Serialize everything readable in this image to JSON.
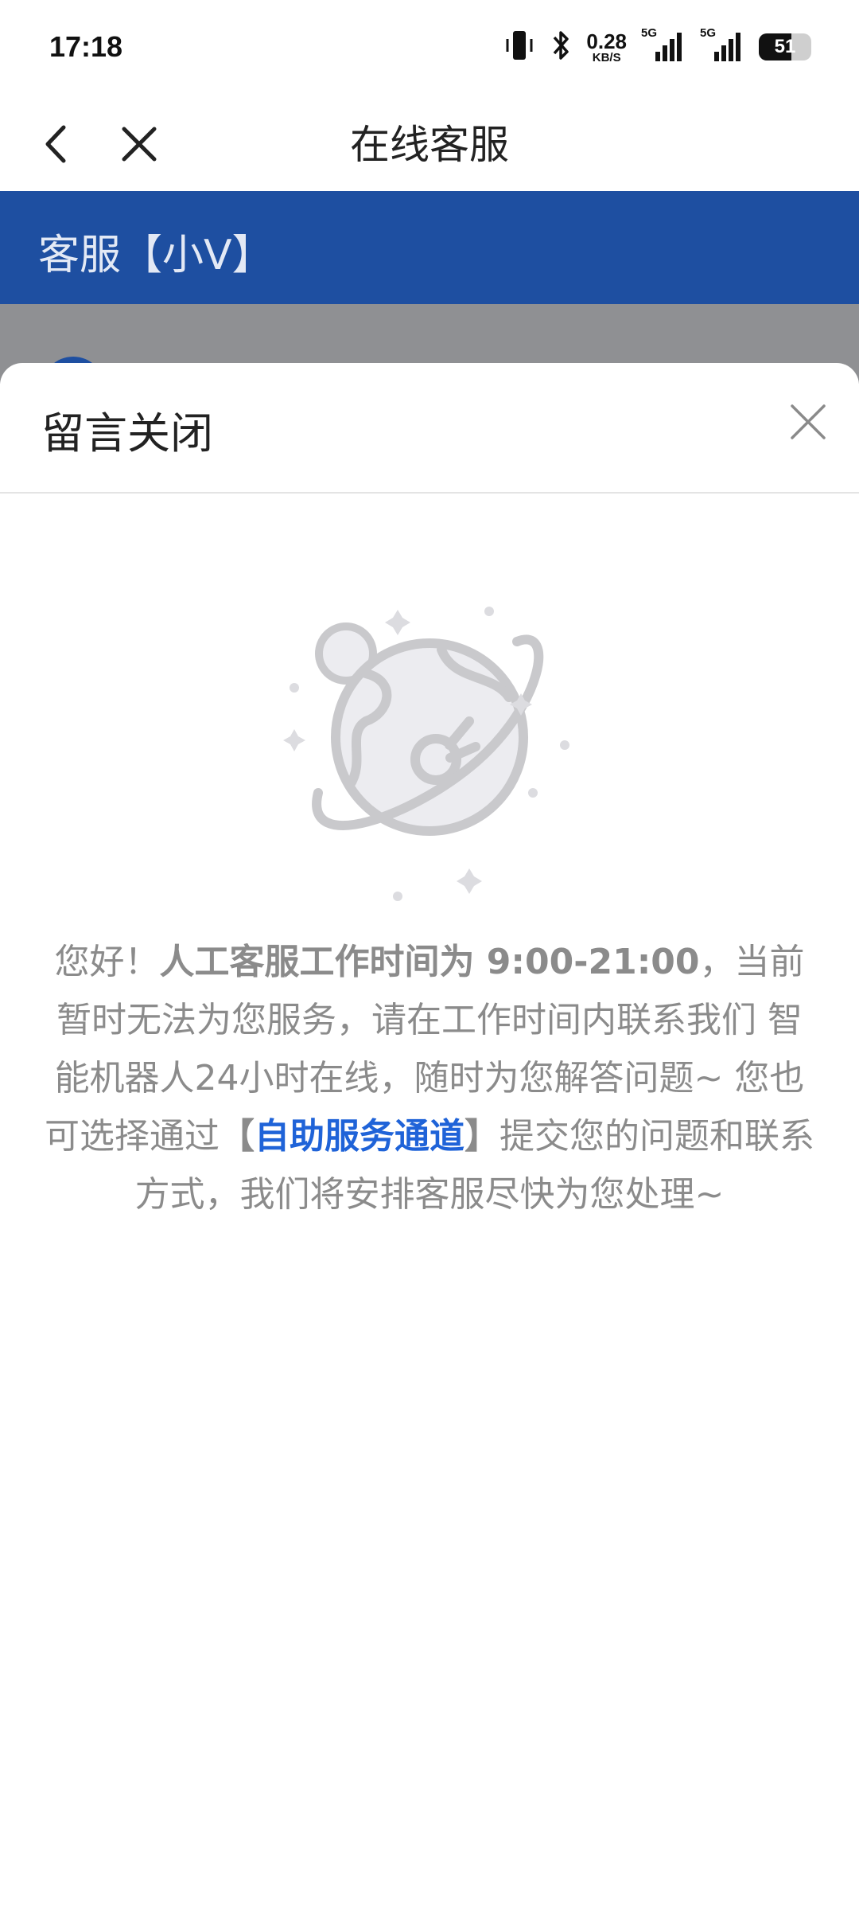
{
  "status_bar": {
    "time": "17:18",
    "net_speed_value": "0.28",
    "net_speed_unit": "KB/S",
    "signal_1_label": "5G",
    "signal_2_label": "5G",
    "battery": "51"
  },
  "nav": {
    "title": "在线客服",
    "back_icon": "chevron-left-icon",
    "close_icon": "close-icon"
  },
  "agent_header": {
    "label": "客服【小V】"
  },
  "sheet": {
    "title": "留言关闭",
    "close_icon": "close-icon",
    "illustration_icon": "planet-icon",
    "message": {
      "greeting": "您好！",
      "hours_label": "人工客服工作时间为 9:00-21:00",
      "after_hours": "，当前暂时无法为您服务，请在工作时间内联系我们",
      "robot_line": "智能机器人24小时在线，随时为您解答问题~",
      "option_prefix": "您也可选择通过",
      "bracket_open": "【",
      "link_text": "自助服务通道",
      "bracket_close": "】",
      "option_suffix": "提交您的问题和联系方式，我们将安排客服尽快为您处理~"
    }
  },
  "colors": {
    "brand_blue": "#1e4fa1",
    "link_blue": "#1f63d8",
    "body_text": "#8b8b8b"
  }
}
